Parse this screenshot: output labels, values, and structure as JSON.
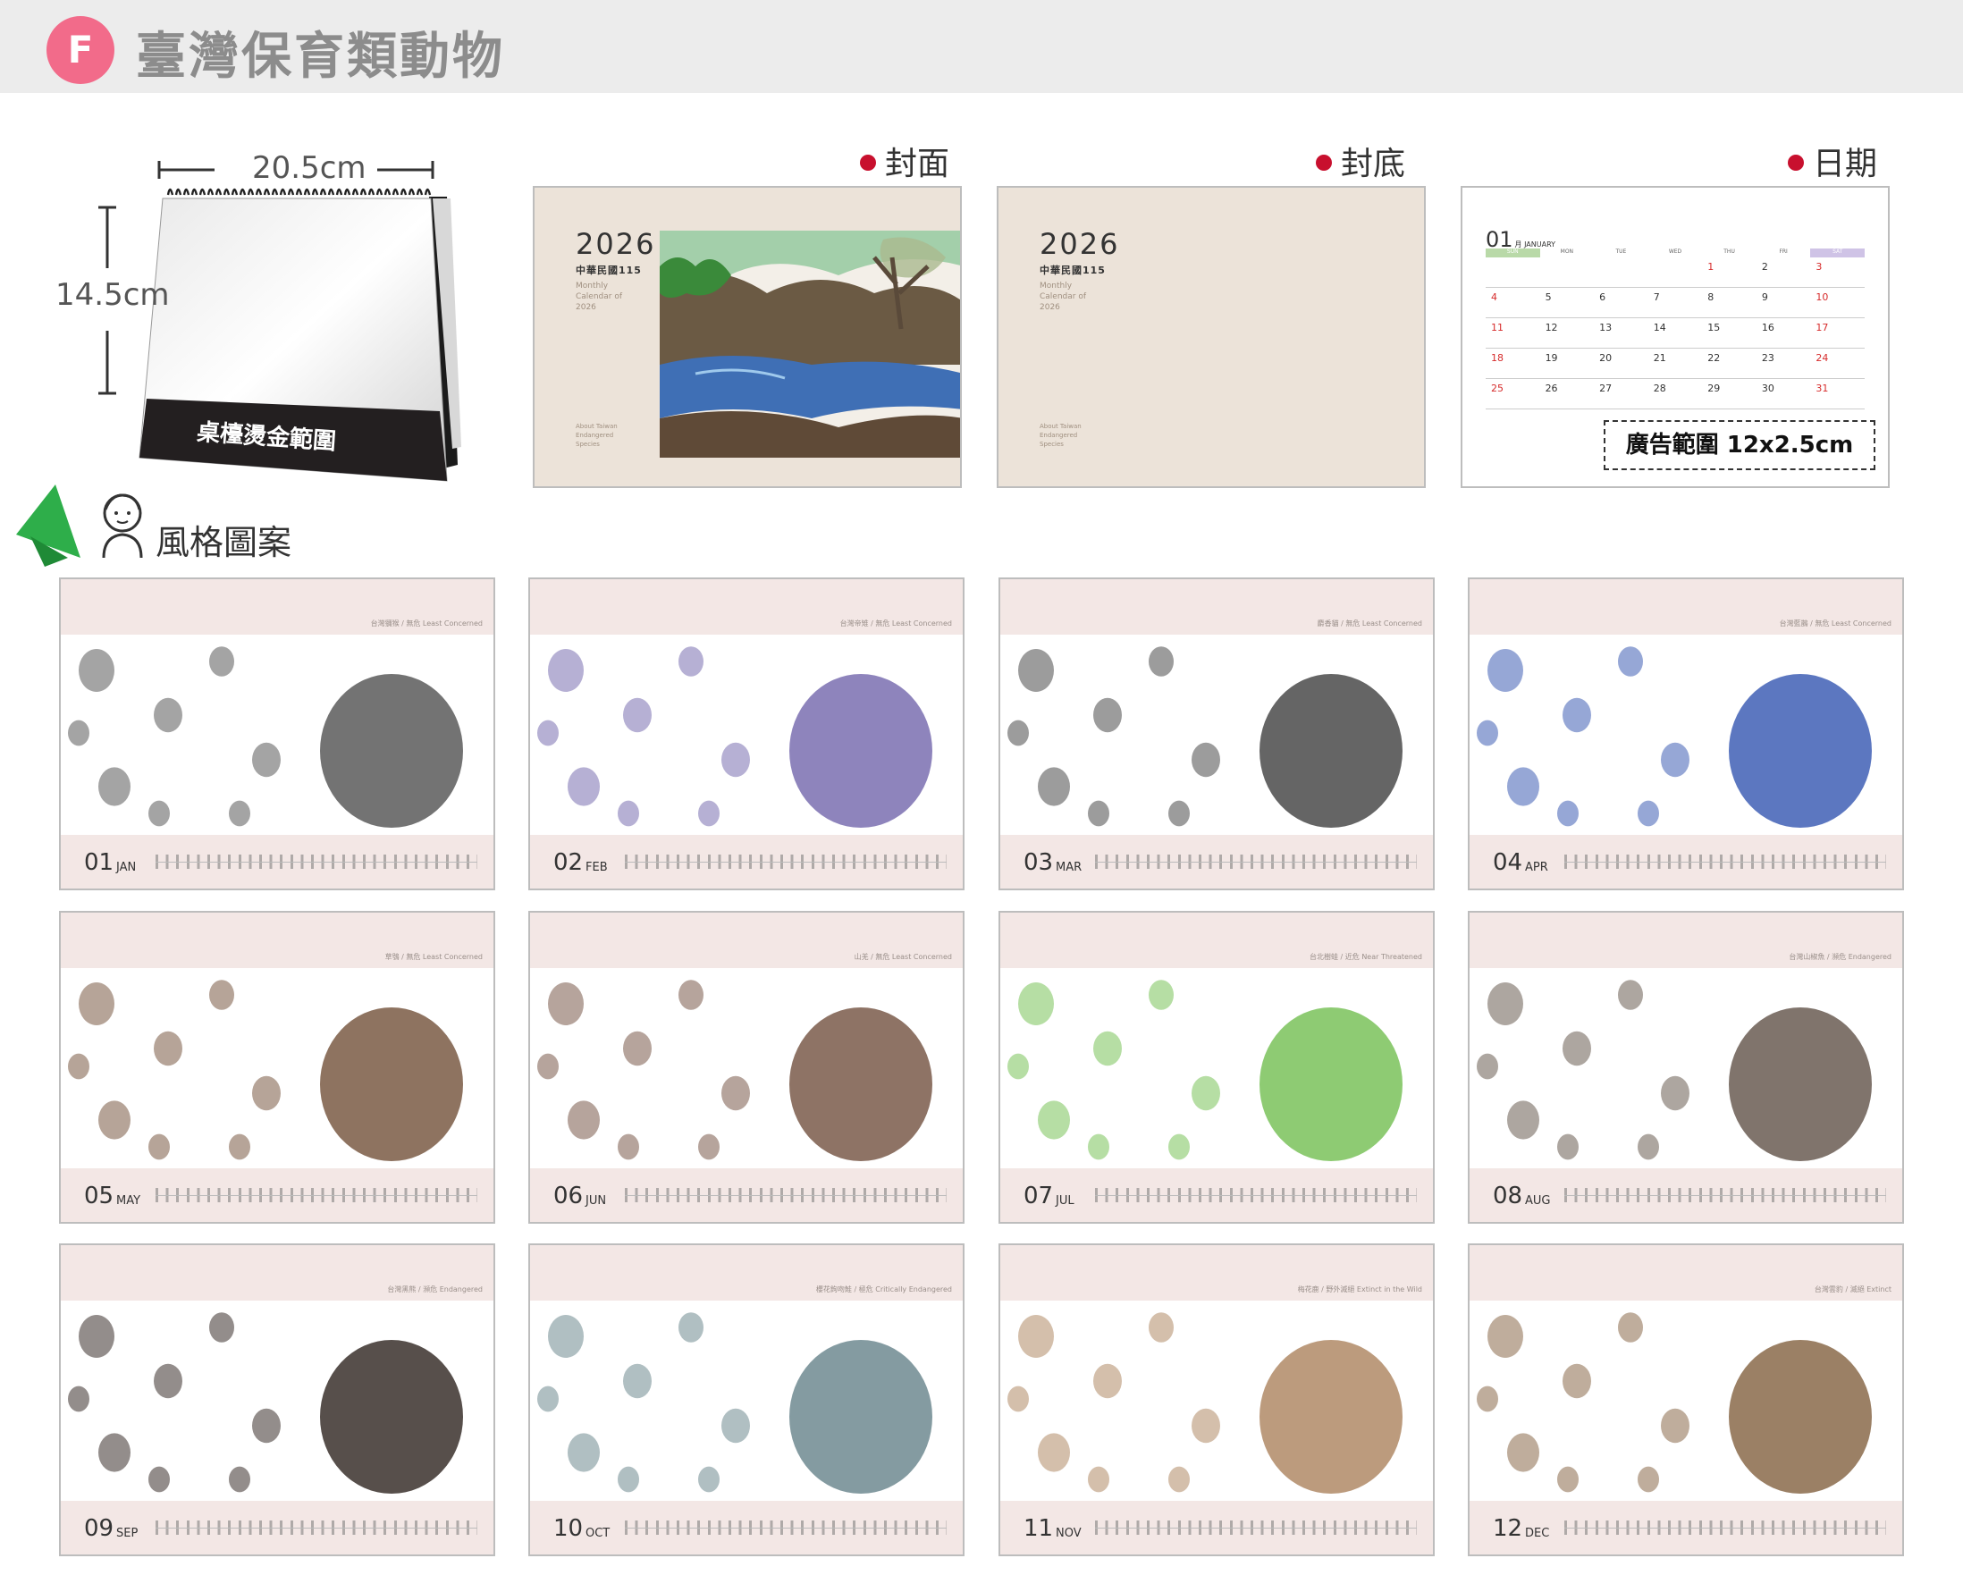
{
  "header": {
    "badge": "F",
    "title": "臺灣保育類動物"
  },
  "product": {
    "width_label": "20.5cm",
    "height_label": "14.5cm",
    "stamp_label": "桌檯燙金範圍"
  },
  "previews": {
    "cover_label": "封面",
    "back_label": "封底",
    "date_label": "日期",
    "cover": {
      "year": "2026",
      "subtitle": "中華民國115",
      "small_text": "Monthly Calendar of 2026",
      "small_text2": "About Taiwan Endangered Species"
    },
    "back": {
      "year": "2026",
      "subtitle": "中華民國115",
      "small_text": "Monthly Calendar of 2026",
      "small_text2": "About Taiwan Endangered Species"
    },
    "date_page": {
      "month_num": "01",
      "month_name": "月 JANUARY",
      "weekdays": [
        "SUN",
        "MON",
        "TUE",
        "WED",
        "THU",
        "FRI",
        "SAT"
      ],
      "weeks": [
        [
          "",
          "",
          "",
          "",
          "1",
          "2",
          "3"
        ],
        [
          "4",
          "5",
          "6",
          "7",
          "8",
          "9",
          "10"
        ],
        [
          "11",
          "12",
          "13",
          "14",
          "15",
          "16",
          "17"
        ],
        [
          "18",
          "19",
          "20",
          "21",
          "22",
          "23",
          "24"
        ],
        [
          "25",
          "26",
          "27",
          "28",
          "29",
          "30",
          "31"
        ]
      ],
      "ad_label": "廣告範圍 12x2.5cm"
    }
  },
  "style_section": {
    "title": "風格圖案"
  },
  "months": [
    {
      "num": "01",
      "mon": "JAN",
      "species": "台灣獼猴 / 無危 Least Concerned"
    },
    {
      "num": "02",
      "mon": "FEB",
      "species": "台灣帝雉 / 無危 Least Concerned"
    },
    {
      "num": "03",
      "mon": "MAR",
      "species": "麝香貓 / 無危 Least Concerned"
    },
    {
      "num": "04",
      "mon": "APR",
      "species": "台灣藍鵲 / 無危 Least Concerned"
    },
    {
      "num": "05",
      "mon": "MAY",
      "species": "草鴞 / 無危 Least Concerned"
    },
    {
      "num": "06",
      "mon": "JUN",
      "species": "山羌 / 無危 Least Concerned"
    },
    {
      "num": "07",
      "mon": "JUL",
      "species": "台北樹蛙 / 近危 Near Threatened"
    },
    {
      "num": "08",
      "mon": "AUG",
      "species": "台灣山椒魚 / 瀕危 Endangered"
    },
    {
      "num": "09",
      "mon": "SEP",
      "species": "台灣黑熊 / 瀕危 Endangered"
    },
    {
      "num": "10",
      "mon": "OCT",
      "species": "櫻花鉤吻鮭 / 極危 Critically Endangered"
    },
    {
      "num": "11",
      "mon": "NOV",
      "species": "梅花鹿 / 野外滅絕 Extinct in the Wild"
    },
    {
      "num": "12",
      "mon": "DEC",
      "species": "台灣雲豹 / 滅絕 Extinct"
    }
  ]
}
